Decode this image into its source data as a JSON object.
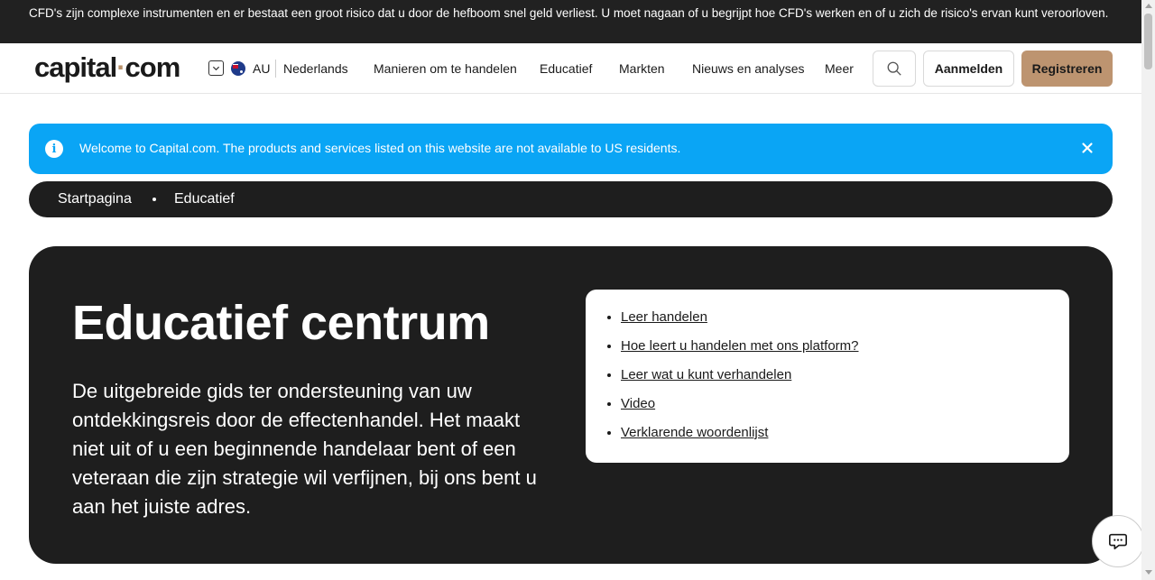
{
  "risk_warning": "CFD's zijn complexe instrumenten en er bestaat een groot risico dat u door de hefboom snel geld verliest. U moet nagaan of u begrijpt hoe CFD's werken en of u zich de risico's ervan kunt veroorloven.",
  "header": {
    "logo": {
      "part1": "capital",
      "dot": "·",
      "part2": "com"
    },
    "region": "AU",
    "language": "Nederlands",
    "nav": [
      "Manieren om te handelen",
      "Educatief",
      "Markten",
      "Nieuws en analyses",
      "Meer"
    ],
    "login_label": "Aanmelden",
    "register_label": "Registreren"
  },
  "notice": {
    "text": "Welcome to Capital.com. The products and services listed on this website are not available to US residents."
  },
  "breadcrumb": [
    "Startpagina",
    "Educatief"
  ],
  "hero": {
    "title": "Educatief centrum",
    "intro": "De uitgebreide gids ter ondersteuning van uw ontdekkingsreis door de effectenhandel. Het maakt niet uit of u een beginnende handelaar bent of een veteraan die zijn strategie wil verfijnen, bij ons bent u aan het juiste adres.",
    "links": [
      "Leer handelen",
      "Hoe leert u handelen met ons platform?",
      "Leer wat u kunt verhandelen",
      "Video",
      "Verklarende woordenlijst"
    ]
  },
  "colors": {
    "brand_accent": "#bd9470",
    "notice_bg": "#0aa5f5",
    "dark_bg": "#1e1e1e"
  }
}
